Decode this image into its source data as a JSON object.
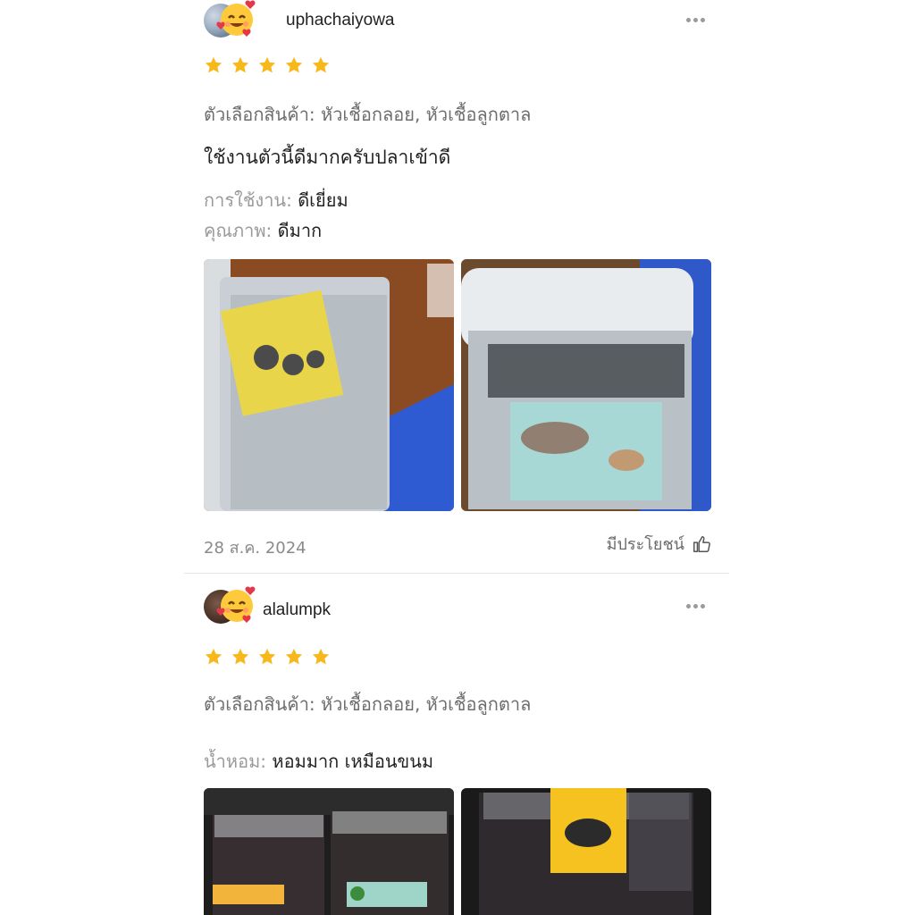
{
  "reviews": [
    {
      "username": "uphachaiyowa",
      "rating": 5,
      "option": "ตัวเลือกสินค้า: หัวเชื้อกลอย, หัวเชื้อลูกตาล",
      "comment": "ใช้งานตัวนี้ดีมากครับปลาเข้าดี",
      "attributes": [
        {
          "key": "การใช้งาน:",
          "value": "ดีเยี่ยม"
        },
        {
          "key": "คุณภาพ:",
          "value": "ดีมาก"
        }
      ],
      "date": "28 ส.ค. 2024",
      "helpful_label": "มีประโยชน์"
    },
    {
      "username": "alalumpk",
      "rating": 5,
      "option": "ตัวเลือกสินค้า: หัวเชื้อกลอย, หัวเชื้อลูกตาล",
      "attributes": [
        {
          "key": "น้ำหอม:",
          "value": "หอมมาก เหมือนขนม"
        }
      ]
    }
  ],
  "colors": {
    "star": "#f7b81b",
    "muted_text": "#9a9a9a",
    "divider": "#e6e6e6"
  },
  "icons": [
    "more-options-icon",
    "star-icon",
    "thumbs-up-icon",
    "smiling-face-with-hearts-emoji"
  ]
}
